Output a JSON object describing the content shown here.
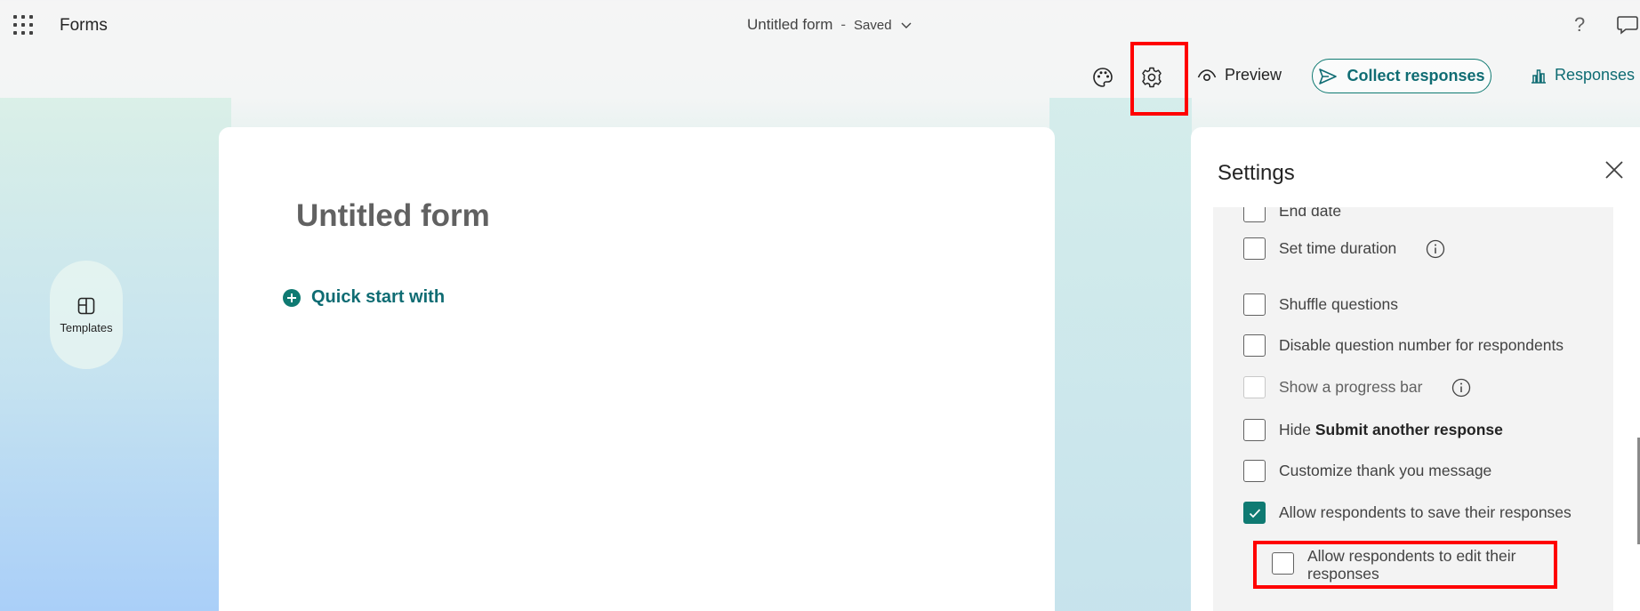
{
  "app": {
    "name": "Forms",
    "doc_title": "Untitled form",
    "separator": "-",
    "save_status": "Saved",
    "help_label": "?"
  },
  "toolbar": {
    "theme_icon": "palette-icon",
    "settings_icon": "gear-icon",
    "preview_label": "Preview",
    "collect_label": "Collect responses",
    "responses_label": "Responses"
  },
  "rail": {
    "templates_label": "Templates"
  },
  "form": {
    "title": "Untitled form",
    "quick_start_label": "Quick start with"
  },
  "settings": {
    "title": "Settings",
    "options": [
      {
        "label": "End date",
        "checked": false
      },
      {
        "label": "Set time duration",
        "checked": false,
        "info": true
      },
      {
        "label": "Shuffle questions",
        "checked": false
      },
      {
        "label": "Disable question number for respondents",
        "checked": false
      },
      {
        "label": "Show a progress bar",
        "checked": false,
        "disabled": true,
        "info": true
      },
      {
        "label_prefix": "Hide",
        "label_bold": "Submit another response",
        "checked": false
      },
      {
        "label": "Customize thank you message",
        "checked": false
      },
      {
        "label": "Allow respondents to save their responses",
        "checked": true
      },
      {
        "label": "Allow respondents to edit their responses",
        "checked": false,
        "sub_option": true
      }
    ]
  },
  "colors": {
    "accent": "#0f7a72",
    "highlight": "#ff0000"
  }
}
